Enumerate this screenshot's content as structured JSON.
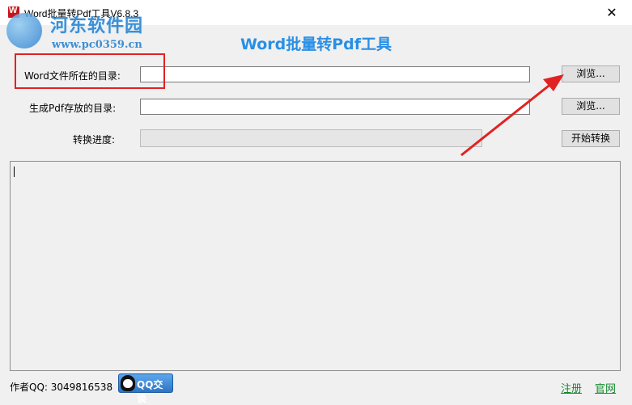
{
  "window": {
    "title": "Word批量转Pdf工具V6.8.3",
    "close_glyph": "✕"
  },
  "watermark": {
    "title": "河东软件园",
    "url": "www.pc0359.cn"
  },
  "heading": "Word批量转Pdf工具",
  "form": {
    "source_dir_label": "Word文件所在的目录:",
    "source_dir_value": "",
    "output_dir_label": "生成Pdf存放的目录:",
    "output_dir_value": "",
    "progress_label": "转换进度:",
    "progress_value": 0
  },
  "buttons": {
    "browse_source": "浏览...",
    "browse_output": "浏览...",
    "start": "开始转换"
  },
  "log": {
    "text": ""
  },
  "footer": {
    "author": "作者QQ: 3049816538",
    "qq_button": "QQ交谈",
    "register": "注册",
    "website": "官网"
  },
  "annotation": {
    "highlight_color": "#e12222",
    "arrow_color": "#e12222"
  }
}
